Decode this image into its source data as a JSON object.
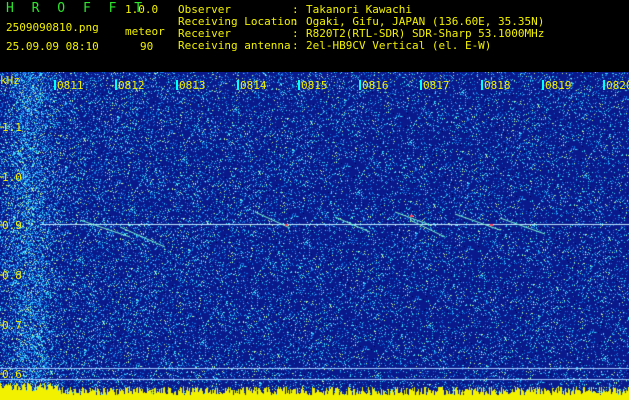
{
  "app": {
    "title": "H R O F F T",
    "version": "1.0.0"
  },
  "file": {
    "name": "2509090810.png",
    "datetime": "25.09.09 08:10"
  },
  "meteor": {
    "label": "meteor",
    "count": "90"
  },
  "info": [
    {
      "key": "Observer",
      "value": "Takanori Kawachi"
    },
    {
      "key": "Receiving Location",
      "value": "Ogaki, Gifu, JAPAN (136.60E, 35.35N)"
    },
    {
      "key": "Receiver",
      "value": "R820T2(RTL-SDR) SDR-Sharp 53.1000MHz"
    },
    {
      "key": "Receiving antenna",
      "value": "2el-HB9CV Vertical (el. E-W)"
    }
  ],
  "plot": {
    "y_unit": "kHz",
    "y_ticks": [
      "1.1",
      "1.0",
      "0.9",
      "0.8",
      "0.7",
      "0.6"
    ],
    "time_ticks": [
      "0811",
      "0812",
      "0813",
      "0814",
      "0815",
      "0816",
      "0817",
      "0818",
      "0819",
      "0820"
    ],
    "colors": {
      "background": "#0a1a8c",
      "label": "#f2f200",
      "marker": "#00ffff"
    }
  }
}
